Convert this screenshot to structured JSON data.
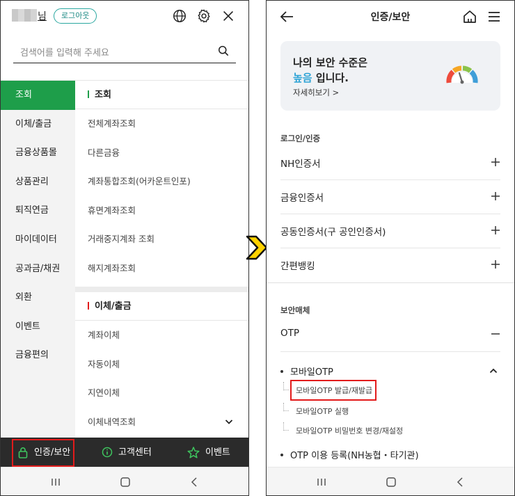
{
  "left": {
    "user_suffix": "님",
    "logout_label": "로그아웃",
    "search_placeholder": "검색어를 입력해 주세요",
    "categories": [
      "조회",
      "이체/출금",
      "금융상품몰",
      "상품관리",
      "퇴직연금",
      "마이데이터",
      "공과금/채권",
      "외환",
      "이벤트",
      "금융편의"
    ],
    "section1_title": "조회",
    "section1_items": [
      "전체계좌조회",
      "다른금융",
      "계좌통합조회(어카운트인포)",
      "휴면계좌조회",
      "거래중지계좌 조회",
      "해지계좌조회"
    ],
    "section2_title": "이체/출금",
    "section2_items": [
      "계좌이체",
      "자동이체",
      "지연이체",
      "이체내역조회"
    ],
    "bottom_bar": {
      "auth_label": "인증/보안",
      "support_label": "고객센터",
      "event_label": "이벤트"
    }
  },
  "right": {
    "title": "인증/보안",
    "security_card": {
      "line1": "나의 보안 수준은",
      "level": "높음",
      "line2_suffix": " 입니다.",
      "more": "자세히보기 >"
    },
    "login_section_label": "로그인/인증",
    "login_items": [
      "NH인증서",
      "금융인증서",
      "공동인증서(구 공인인증서)",
      "간편뱅킹"
    ],
    "media_section_label": "보안매체",
    "otp_label": "OTP",
    "mobile_otp_label": "모바일OTP",
    "mobile_otp_children": [
      "모바일OTP 발급/재발급",
      "모바일OTP 실행",
      "모바일OTP 비밀번호 변경/재설정"
    ],
    "otp_register_label": "OTP 이용 등록(NH농협・타기관)"
  },
  "colors": {
    "brand_green": "#1e9e4a",
    "highlight_red": "#e21b1b",
    "level_blue": "#2da3d6",
    "arrow_yellow": "#ffd200"
  }
}
